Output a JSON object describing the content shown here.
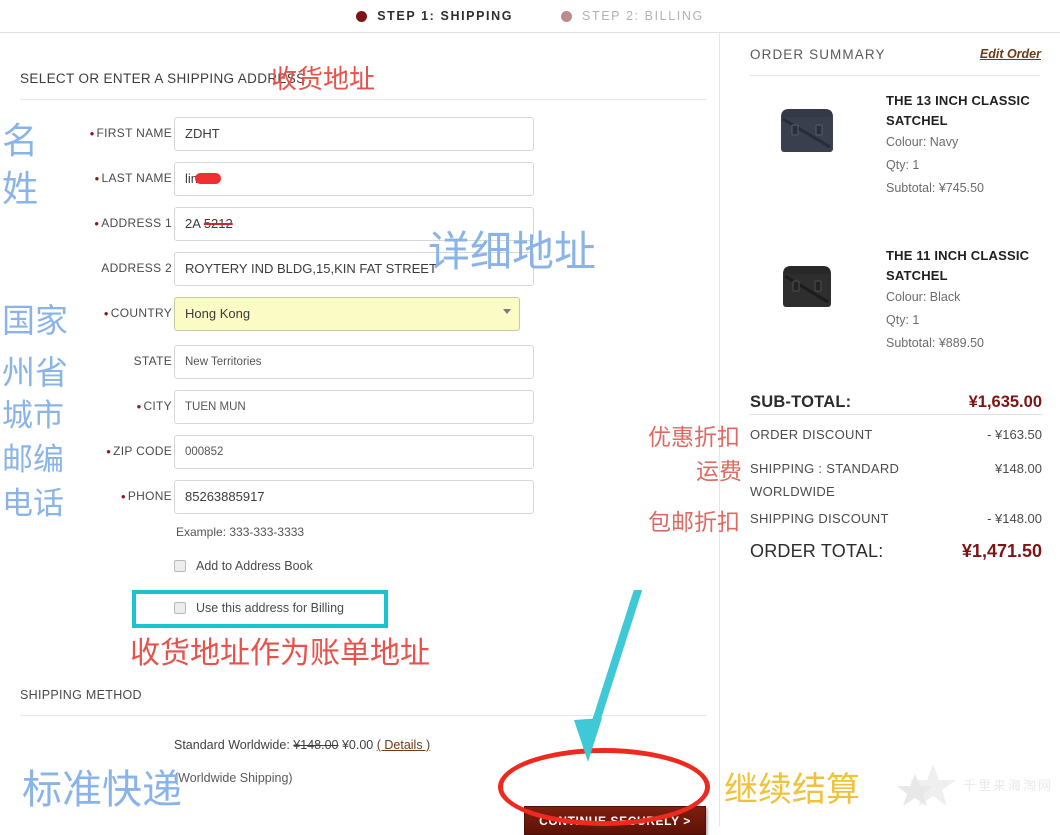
{
  "steps": [
    {
      "label": "STEP 1: SHIPPING",
      "state": "active"
    },
    {
      "label": "STEP 2: BILLING",
      "state": "inactive"
    }
  ],
  "shipping": {
    "section_title": "SELECT OR ENTER A SHIPPING ADDRESS",
    "fields": [
      {
        "label": "FIRST NAME",
        "required": true,
        "value": "ZDHT",
        "placeholder": ""
      },
      {
        "label": "LAST NAME",
        "required": true,
        "value": "lin",
        "placeholder": ""
      },
      {
        "label": "ADDRESS 1",
        "required": true,
        "value": "2A",
        "struck": "5212",
        "placeholder": ""
      },
      {
        "label": "ADDRESS 2",
        "required": false,
        "value": "ROYTERY IND BLDG,15,KIN FAT STREET",
        "placeholder": ""
      },
      {
        "label": "COUNTRY",
        "required": true,
        "value": "Hong Kong",
        "type": "select"
      },
      {
        "label": "STATE",
        "required": false,
        "value": "New Territories",
        "placeholder": ""
      },
      {
        "label": "CITY",
        "required": true,
        "value": "TUEN MUN",
        "placeholder": ""
      },
      {
        "label": "ZIP CODE",
        "required": true,
        "value": "000852",
        "placeholder": ""
      },
      {
        "label": "PHONE",
        "required": true,
        "value": "85263885917",
        "placeholder": ""
      }
    ],
    "phone_hint": "Example: 333-333-3333",
    "checkbox_address_book": "Add to Address Book",
    "checkbox_billing": "Use this address for Billing",
    "method_title": "SHIPPING METHOD",
    "method_line_prefix": "Standard Worldwide:",
    "method_old_price": "¥148.00",
    "method_new_price": "¥0.00",
    "method_details": "( Details )",
    "method_sub": "(Worldwide Shipping)",
    "continue_label": "CONTINUE SECURELY >"
  },
  "order_summary": {
    "title": "ORDER SUMMARY",
    "edit_link": "Edit Order",
    "products": [
      {
        "name": "THE 13 INCH CLASSIC SATCHEL",
        "colour_label": "Colour: Navy",
        "qty_label": "Qty: 1",
        "subtotal_label": "Subtotal: ¥745.50",
        "swatch": "#3a3f4d"
      },
      {
        "name": "THE 11 INCH CLASSIC SATCHEL",
        "colour_label": "Colour: Black",
        "qty_label": "Qty: 1",
        "subtotal_label": "Subtotal: ¥889.50",
        "swatch": "#2e2e2e"
      }
    ],
    "totals": [
      {
        "label": "SUB-TOTAL:",
        "value": "¥1,635.00",
        "style": "big"
      },
      {
        "label": "ORDER DISCOUNT",
        "value": "- ¥163.50",
        "style": "normal"
      },
      {
        "label": "SHIPPING : STANDARD WORLDWIDE",
        "value": "¥148.00",
        "style": "normal"
      },
      {
        "label": "SHIPPING DISCOUNT",
        "value": "- ¥148.00",
        "style": "normal"
      },
      {
        "label": "ORDER TOTAL:",
        "value": "¥1,471.50",
        "style": "huge"
      }
    ]
  },
  "annotations": {
    "title_cn": "收货地址",
    "first_name_cn": "名",
    "last_name_cn": "姓",
    "address_cn": "详细地址",
    "country_cn": "国家",
    "state_cn": "州省",
    "city_cn": "城市",
    "zip_cn": "邮编",
    "phone_cn": "电话",
    "billing_cn": "收货地址作为账单地址",
    "discount_cn": "优惠折扣",
    "shipping_fee_cn": "运费",
    "free_shipping_cn": "包邮折扣",
    "standard_shipping_cn": "标准快递",
    "continue_cn": "继续结算"
  },
  "watermark": {
    "text": "千里来海淘网"
  },
  "colors": {
    "brand_dark_red": "#7d2010",
    "accent_teal": "#19c4cf",
    "annotation_red": "#e8524a",
    "annotation_blue": "#8ab4e8",
    "annotation_gold": "#f0c23a",
    "autofill_yellow": "#fbfbc6"
  }
}
